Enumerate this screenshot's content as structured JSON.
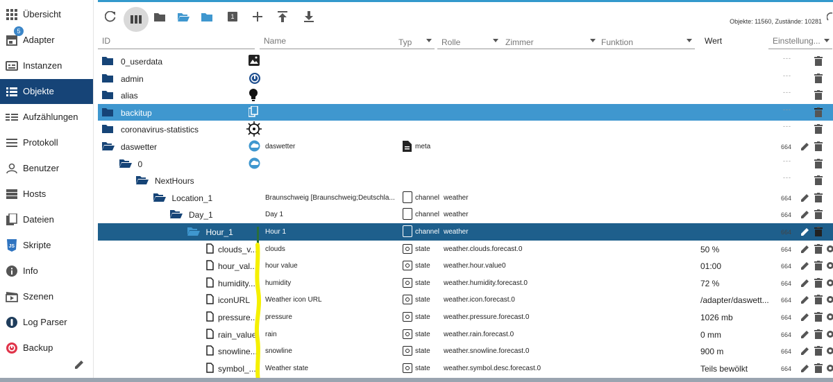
{
  "sidebar": {
    "items": [
      {
        "label": "Übersicht",
        "icon": "grid-icon"
      },
      {
        "label": "Adapter",
        "icon": "store-icon",
        "badge": "5"
      },
      {
        "label": "Instanzen",
        "icon": "instances-icon"
      },
      {
        "label": "Objekte",
        "icon": "list-icon",
        "active": true
      },
      {
        "label": "Aufzählungen",
        "icon": "enums-icon"
      },
      {
        "label": "Protokoll",
        "icon": "log-icon"
      },
      {
        "label": "Benutzer",
        "icon": "user-icon"
      },
      {
        "label": "Hosts",
        "icon": "hosts-icon"
      },
      {
        "label": "Dateien",
        "icon": "files-icon"
      },
      {
        "label": "Skripte",
        "icon": "javascript-icon"
      },
      {
        "label": "Info",
        "icon": "info-icon"
      },
      {
        "label": "Szenen",
        "icon": "scenes-icon"
      },
      {
        "label": "Log Parser",
        "icon": "logparser-icon"
      },
      {
        "label": "Backup",
        "icon": "backup-icon"
      }
    ]
  },
  "toolbar": {
    "stats": "Objekte: 11560, Zustände: 10281",
    "count_badge": "1"
  },
  "columns": {
    "id": "ID",
    "name": "Name",
    "type": "Typ",
    "role": "Rolle",
    "room": "Zimmer",
    "function": "Funktion",
    "value": "Wert",
    "settings": "Einstellung..."
  },
  "rows": [
    {
      "id": "0_userdata",
      "level": 0,
      "kind": "folder"
    },
    {
      "id": "admin",
      "level": 0,
      "kind": "folder"
    },
    {
      "id": "alias",
      "level": 0,
      "kind": "folder"
    },
    {
      "id": "backitup",
      "level": 0,
      "kind": "folder",
      "selected": "light"
    },
    {
      "id": "coronavirus-statistics",
      "level": 0,
      "kind": "folder"
    },
    {
      "id": "daswetter",
      "level": 0,
      "kind": "folder-open",
      "name": "daswetter",
      "type": "meta",
      "perm": "664"
    },
    {
      "id": "0",
      "level": 1,
      "kind": "folder-open"
    },
    {
      "id": "NextHours",
      "level": 2,
      "kind": "folder-open"
    },
    {
      "id": "Location_1",
      "level": 3,
      "kind": "folder-open",
      "name": "Braunschweig [Braunschweig;Deutschla...",
      "type": "channel",
      "role": "weather",
      "perm": "664"
    },
    {
      "id": "Day_1",
      "level": 4,
      "kind": "folder-open",
      "name": "Day 1",
      "type": "channel",
      "role": "weather",
      "perm": "664"
    },
    {
      "id": "Hour_1",
      "level": 5,
      "kind": "folder-open",
      "name": "Hour 1",
      "type": "channel",
      "role": "weather",
      "perm": "664",
      "selected": "dark"
    },
    {
      "id": "clouds_v...",
      "level": 6,
      "kind": "file",
      "name": "clouds",
      "type": "state",
      "role": "weather.clouds.forecast.0",
      "value": "50 %",
      "perm": "664"
    },
    {
      "id": "hour_val...",
      "level": 6,
      "kind": "file",
      "name": "hour value",
      "type": "state",
      "role": "weather.hour.value0",
      "value": "01:00",
      "perm": "664"
    },
    {
      "id": "humidity...",
      "level": 6,
      "kind": "file",
      "name": "humidity",
      "type": "state",
      "role": "weather.humidity.forecast.0",
      "value": "72 %",
      "perm": "664"
    },
    {
      "id": "iconURL",
      "level": 6,
      "kind": "file",
      "name": "Weather icon URL",
      "type": "state",
      "role": "weather.icon.forecast.0",
      "value": "/adapter/daswett...",
      "perm": "664"
    },
    {
      "id": "pressure...",
      "level": 6,
      "kind": "file",
      "name": "pressure",
      "type": "state",
      "role": "weather.pressure.forecast.0",
      "value": "1026 mb",
      "perm": "664"
    },
    {
      "id": "rain_value",
      "level": 6,
      "kind": "file",
      "name": "rain",
      "type": "state",
      "role": "weather.rain.forecast.0",
      "value": "0 mm",
      "perm": "664"
    },
    {
      "id": "snowline...",
      "level": 6,
      "kind": "file",
      "name": "snowline",
      "type": "state",
      "role": "weather.snowline.forecast.0",
      "value": "900 m",
      "perm": "664"
    },
    {
      "id": "symbol_...",
      "level": 6,
      "kind": "file",
      "name": "Weather state",
      "type": "state",
      "role": "weather.symbol.desc.forecast.0",
      "value": "Teils bewölkt",
      "perm": "664"
    }
  ],
  "colors": {
    "sidebar_active": "#164477",
    "row_selected_light": "#3f97cf",
    "row_selected_dark": "#1e5f8c",
    "folder": "#164477",
    "accent": "#3399cc",
    "annotation_line": "#f5f000"
  }
}
